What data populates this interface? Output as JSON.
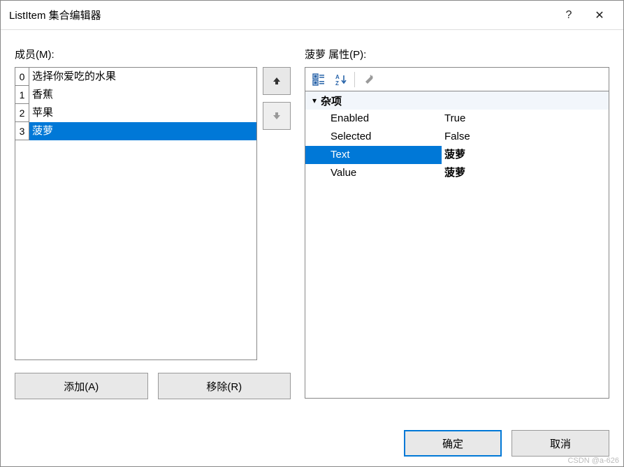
{
  "window": {
    "title": "ListItem 集合编辑器",
    "help": "?",
    "close": "✕"
  },
  "membersLabel": "成员(M):",
  "members": [
    {
      "index": "0",
      "label": "选择你爱吃的水果",
      "selected": false
    },
    {
      "index": "1",
      "label": "香蕉",
      "selected": false
    },
    {
      "index": "2",
      "label": "苹果",
      "selected": false
    },
    {
      "index": "3",
      "label": "菠萝",
      "selected": true
    }
  ],
  "buttons": {
    "up": "⬆",
    "down": "⬇",
    "add": "添加(A)",
    "remove": "移除(R)",
    "ok": "确定",
    "cancel": "取消"
  },
  "propertiesLabel": "菠萝 属性(P):",
  "category": "杂项",
  "properties": [
    {
      "name": "Enabled",
      "value": "True",
      "selected": false,
      "bold": false
    },
    {
      "name": "Selected",
      "value": "False",
      "selected": false,
      "bold": false
    },
    {
      "name": "Text",
      "value": "菠萝",
      "selected": true,
      "bold": true
    },
    {
      "name": "Value",
      "value": "菠萝",
      "selected": false,
      "bold": true
    }
  ],
  "watermark": "CSDN @a-626"
}
